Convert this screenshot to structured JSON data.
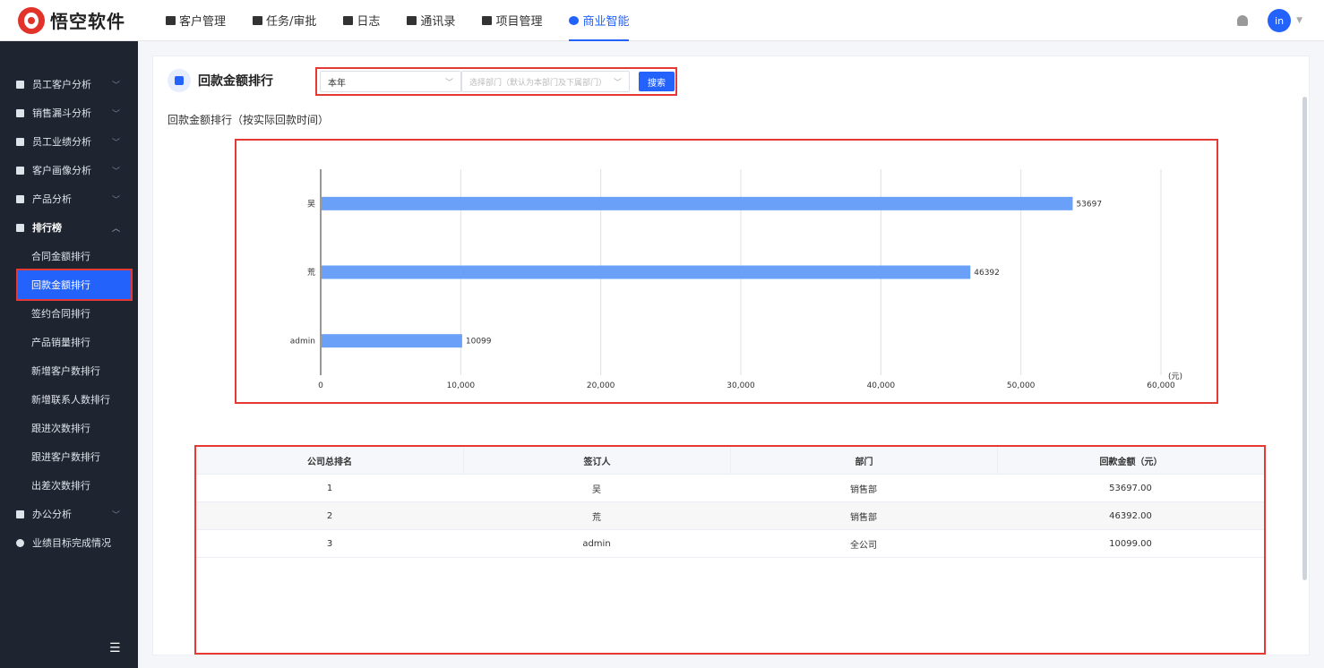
{
  "topbar": {
    "brand": "悟空软件",
    "nav": [
      {
        "label": "客户管理",
        "icon": "building-icon"
      },
      {
        "label": "任务/审批",
        "icon": "briefcase-icon"
      },
      {
        "label": "日志",
        "icon": "log-icon"
      },
      {
        "label": "通讯录",
        "icon": "contacts-icon"
      },
      {
        "label": "项目管理",
        "icon": "project-icon"
      },
      {
        "label": "商业智能",
        "icon": "bi-icon",
        "active": true
      }
    ],
    "avatar_text": "in"
  },
  "sidebar": {
    "groups": [
      {
        "label": "员工客户分析"
      },
      {
        "label": "销售漏斗分析"
      },
      {
        "label": "员工业绩分析"
      },
      {
        "label": "客户画像分析"
      },
      {
        "label": "产品分析"
      },
      {
        "label": "排行榜"
      }
    ],
    "sub_items": [
      {
        "label": "合同金额排行"
      },
      {
        "label": "回款金额排行"
      },
      {
        "label": "签约合同排行"
      },
      {
        "label": "产品销量排行"
      },
      {
        "label": "新增客户数排行"
      },
      {
        "label": "新增联系人数排行"
      },
      {
        "label": "跟进次数排行"
      },
      {
        "label": "跟进客户数排行"
      },
      {
        "label": "出差次数排行"
      }
    ],
    "after_groups": [
      {
        "label": "办公分析"
      },
      {
        "label": "业绩目标完成情况"
      }
    ]
  },
  "main": {
    "title": "回款金额排行",
    "filter_period": "本年",
    "filter_dept_placeholder": "选择部门（默认为本部门及下属部门）",
    "search_label": "搜索",
    "chart_caption": "回款金额排行（按实际回款时间）"
  },
  "chart_data": {
    "type": "bar",
    "orientation": "horizontal",
    "categories": [
      "吴",
      "荒",
      "admin"
    ],
    "values": [
      53697,
      46392,
      10099
    ],
    "unit_label": "(元)",
    "xlim": [
      0,
      60000
    ],
    "ticks": [
      "0",
      "10,000",
      "20,000",
      "30,000",
      "40,000",
      "50,000",
      "60,000"
    ],
    "tick_values": [
      0,
      10000,
      20000,
      30000,
      40000,
      50000,
      60000
    ],
    "grid": true,
    "bar_color": "#6aa0f8"
  },
  "table": {
    "headers": [
      "公司总排名",
      "签订人",
      "部门",
      "回款金额（元）"
    ],
    "rows": [
      [
        "1",
        "吴",
        "销售部",
        "53697.00"
      ],
      [
        "2",
        "荒",
        "销售部",
        "46392.00"
      ],
      [
        "3",
        "admin",
        "全公司",
        "10099.00"
      ]
    ]
  }
}
